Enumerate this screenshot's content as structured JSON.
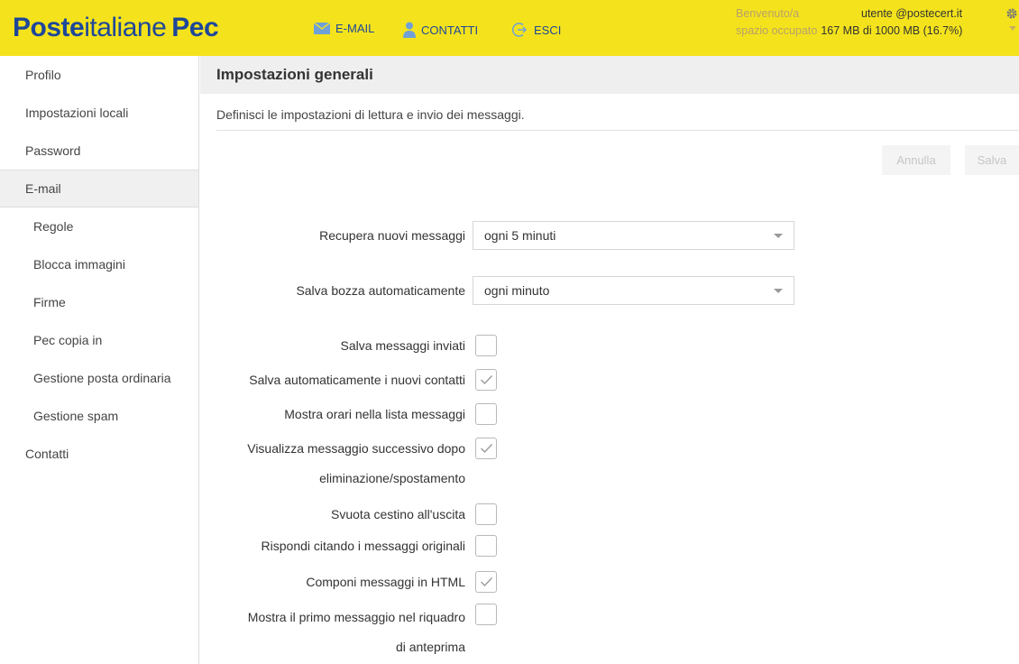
{
  "header": {
    "logo_poste": "Poste",
    "logo_italiane": "italiane",
    "logo_pec": "Pec",
    "nav_email": "E-MAIL",
    "nav_contatti": "CONTATTI",
    "nav_esci": "ESCI",
    "welcome": "Benvenuto/a",
    "user": "utente @postecert.it",
    "space_label": "spazio occupato",
    "space_value": "167 MB di 1000 MB (16.7%)"
  },
  "sidebar": {
    "items": [
      {
        "label": "Profilo"
      },
      {
        "label": "Impostazioni locali"
      },
      {
        "label": "Password"
      },
      {
        "label": "E-mail"
      },
      {
        "label": "Regole"
      },
      {
        "label": "Blocca immagini"
      },
      {
        "label": "Firme"
      },
      {
        "label": "Pec copia in"
      },
      {
        "label": "Gestione posta ordinaria"
      },
      {
        "label": "Gestione spam"
      },
      {
        "label": "Contatti"
      }
    ]
  },
  "main": {
    "title": "Impostazioni generali",
    "description": "Definisci le impostazioni di lettura e invio dei messaggi.",
    "cancel_label": "Annulla",
    "save_label": "Salva",
    "fetch_label": "Recupera nuovi messaggi",
    "fetch_value": "ogni 5 minuti",
    "draft_label": "Salva bozza automaticamente",
    "draft_value": "ogni minuto",
    "options": [
      {
        "label": "Salva messaggi inviati",
        "checked": false
      },
      {
        "label": "Salva automaticamente i nuovi contatti",
        "checked": true
      },
      {
        "label": "Mostra orari nella lista messaggi",
        "checked": false
      },
      {
        "label": "Visualizza messaggio successivo dopo",
        "label2": "eliminazione/spostamento",
        "checked": true
      },
      {
        "label": "Svuota cestino all'uscita",
        "checked": false
      },
      {
        "label": "Rispondi citando i messaggi originali",
        "checked": false
      },
      {
        "label": "Componi messaggi in HTML",
        "checked": true
      },
      {
        "label": "Mostra il primo messaggio nel riquadro",
        "label2": "di anteprima",
        "checked": false
      }
    ]
  },
  "colors": {
    "header_bg": "#f4e31c",
    "brand_blue": "#1e4799"
  }
}
